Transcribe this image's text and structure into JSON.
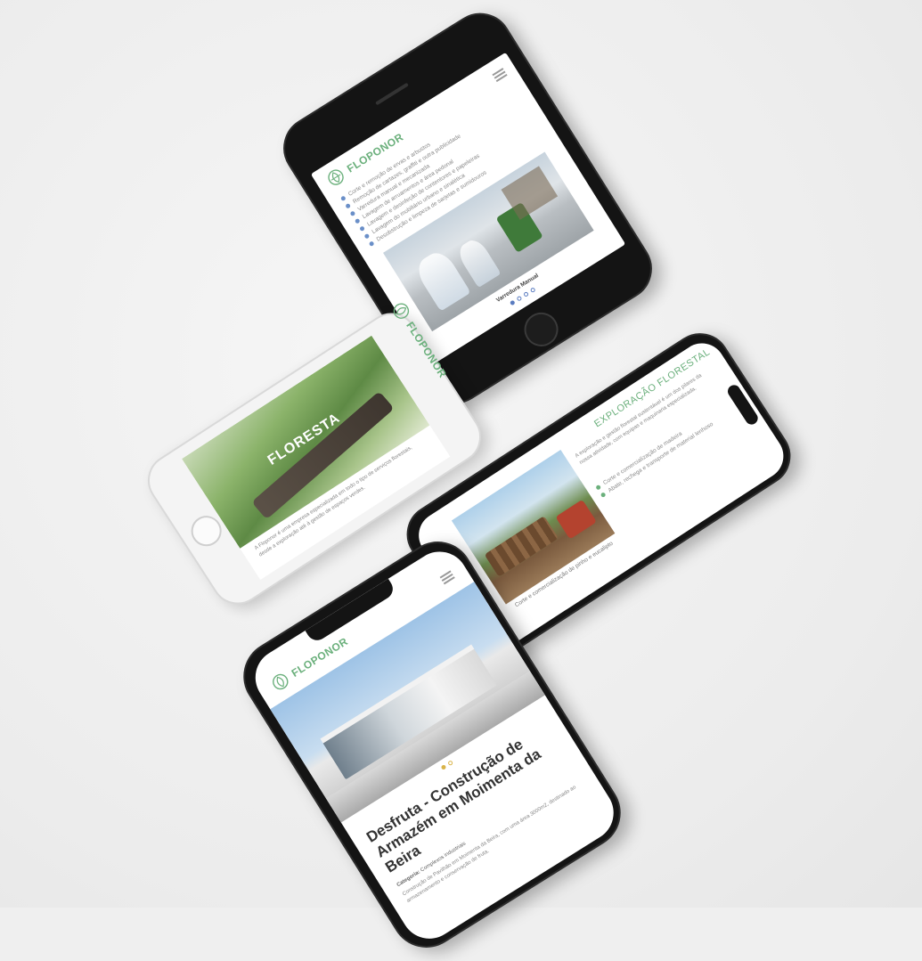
{
  "brand": {
    "name": "FLOPONOR"
  },
  "phone_top": {
    "services": [
      "Corte e remoção de ervas e arbustos",
      "Remoção de cartazes, graffiti e outra publicidade",
      "Varredura manual e mecanizada",
      "Lavagem de arruamentos e área pedonal",
      "Lavagem e desinfeção de contentores e papeleiras",
      "Lavagem do mobiliário urbano e sinalética",
      "Desobstrução e limpeza de sarjetas e sumidouros"
    ],
    "caption": "Varredura Manual"
  },
  "phone_white": {
    "hero_title": "FLORESTA",
    "paragraph": "A Floponor é uma empresa especializada em todo o tipo de serviços florestais, desde a exploração até à gestão de espaços verdes."
  },
  "phone_right": {
    "title": "EXPLORAÇÃO FLORESTAL",
    "paragraph": "A exploração e gestão florestal sustentável é um dos pilares da nossa atividade, com equipas e maquinaria especializada.",
    "bullets": [
      "Corte e comercialização de madeira",
      "Abate, rechega e transporte de material lenhoso"
    ],
    "caption": "Corte e comercialização de pinho e eucalipto"
  },
  "phone_bottom": {
    "title": "Desfruta - Construção de Armazém em Moimenta da Beira",
    "category_label": "Categoria:",
    "category_value": "Complexos industriais",
    "description": "Construção de Pavilhão em Moimenta da Beira, com uma área 3000m2, destinado ao armazenamento e conservação de fruta."
  },
  "colors": {
    "accent_green": "#6bb07c",
    "dot_blue": "#5a7cc0"
  },
  "icons": [
    "logo-icon",
    "menu-icon",
    "home-button",
    "speaker",
    "camera"
  ]
}
